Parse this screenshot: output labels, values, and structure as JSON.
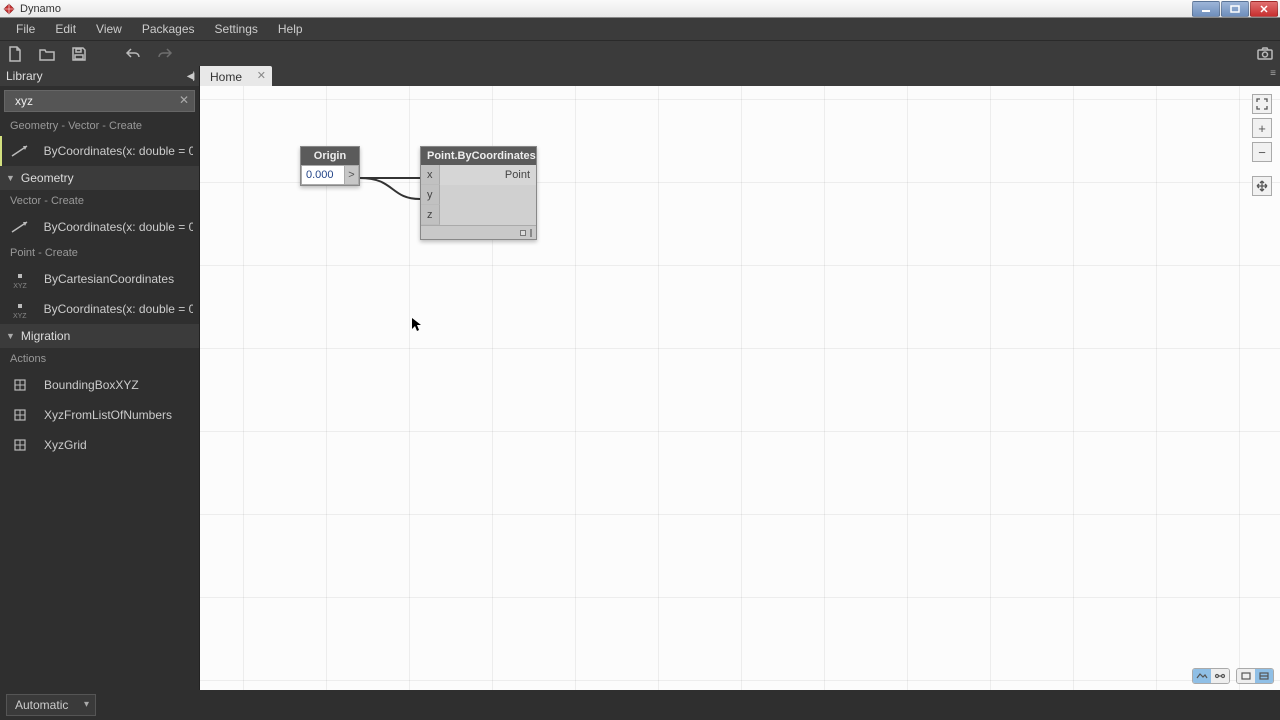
{
  "app": {
    "title": "Dynamo"
  },
  "menus": [
    "File",
    "Edit",
    "View",
    "Packages",
    "Settings",
    "Help"
  ],
  "library": {
    "title": "Library",
    "search_value": "xyz",
    "crumb_top": "Geometry - Vector - Create",
    "item_top": "ByCoordinates(x: double = 0",
    "cat_geometry": "Geometry",
    "sub_vector": "Vector - Create",
    "item_vec": "ByCoordinates(x: double = 0",
    "sub_point": "Point - Create",
    "item_cart": "ByCartesianCoordinates",
    "item_pt": "ByCoordinates(x: double = 0",
    "cat_migration": "Migration",
    "sub_actions": "Actions",
    "item_bbox": "BoundingBoxXYZ",
    "item_xyzlist": "XyzFromListOfNumbers",
    "item_xyzgrid": "XyzGrid"
  },
  "tabs": {
    "home": "Home"
  },
  "nodes": {
    "origin": {
      "title": "Origin",
      "value": "0.000",
      "out": ">"
    },
    "point": {
      "title": "Point.ByCoordinates",
      "in_x": "x",
      "in_y": "y",
      "in_z": "z",
      "out": "Point"
    }
  },
  "status": {
    "run_mode": "Automatic"
  }
}
